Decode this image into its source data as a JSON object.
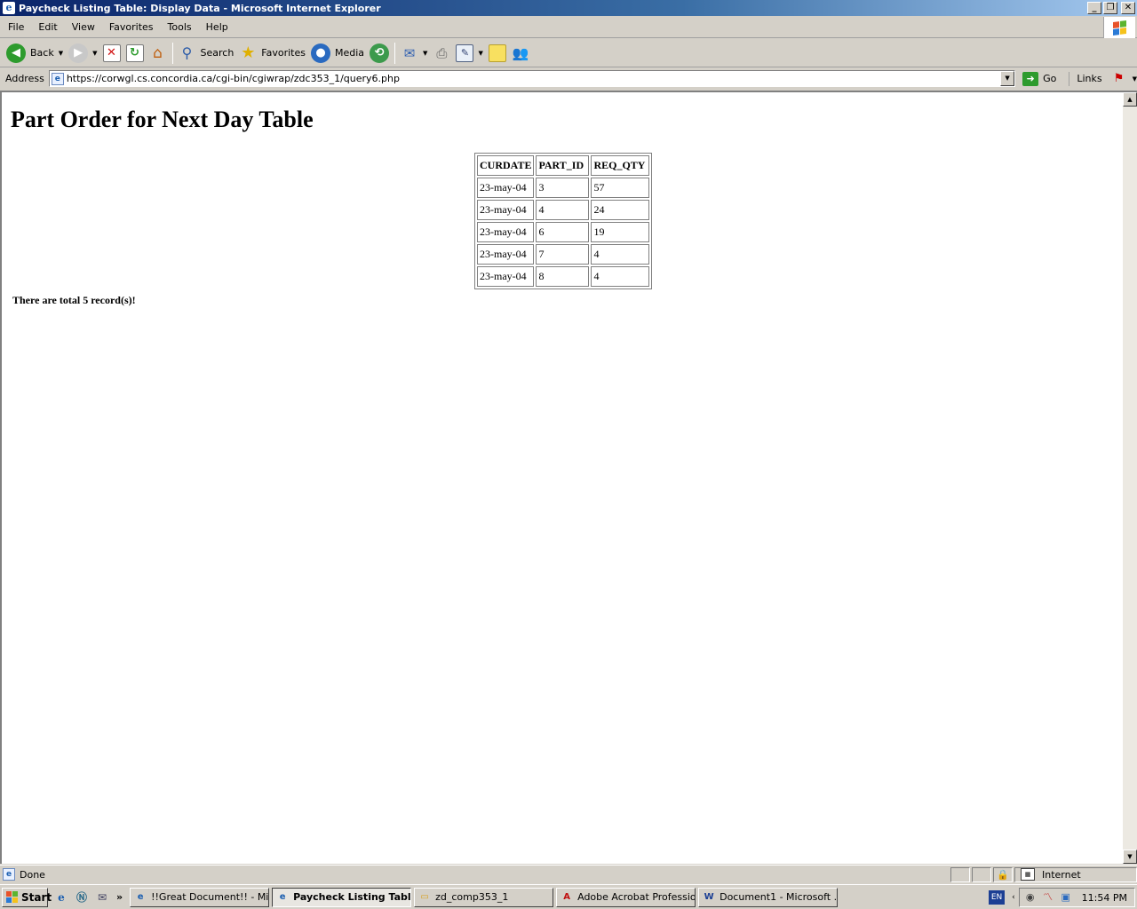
{
  "window": {
    "title": "Paycheck Listing Table: Display Data - Microsoft Internet Explorer"
  },
  "menu": [
    "File",
    "Edit",
    "View",
    "Favorites",
    "Tools",
    "Help"
  ],
  "toolbar": {
    "back": "Back",
    "search": "Search",
    "favorites": "Favorites",
    "media": "Media"
  },
  "address": {
    "label": "Address",
    "url": "https://corwgl.cs.concordia.ca/cgi-bin/cgiwrap/zdc353_1/query6.php",
    "go": "Go",
    "links": "Links"
  },
  "page": {
    "heading": "Part Order for Next Day Table",
    "table": {
      "headers": [
        "CURDATE",
        "PART_ID",
        "REQ_QTY"
      ],
      "rows": [
        [
          "23-may-04",
          "3",
          "57"
        ],
        [
          "23-may-04",
          "4",
          "24"
        ],
        [
          "23-may-04",
          "6",
          "19"
        ],
        [
          "23-may-04",
          "7",
          "4"
        ],
        [
          "23-may-04",
          "8",
          "4"
        ]
      ]
    },
    "summary": "There are total 5 record(s)!"
  },
  "status": {
    "text": "Done",
    "zone": "Internet"
  },
  "taskbar": {
    "start": "Start",
    "tasks": [
      {
        "label": "!!Great Document!! - Mic...",
        "icon": "ie-icon",
        "active": false
      },
      {
        "label": "Paycheck Listing Tabl...",
        "icon": "ie-icon",
        "active": true
      },
      {
        "label": "zd_comp353_1",
        "icon": "folder-icon",
        "active": false
      },
      {
        "label": "Adobe Acrobat Professio...",
        "icon": "acrobat-icon",
        "active": false
      },
      {
        "label": "Document1 - Microsoft ...",
        "icon": "word-icon",
        "active": false
      }
    ],
    "language": "EN",
    "clock": "11:54 PM"
  },
  "colors": {
    "titlebar_start": "#0a246a",
    "titlebar_end": "#a6caf0",
    "chrome": "#d4d0c8"
  }
}
